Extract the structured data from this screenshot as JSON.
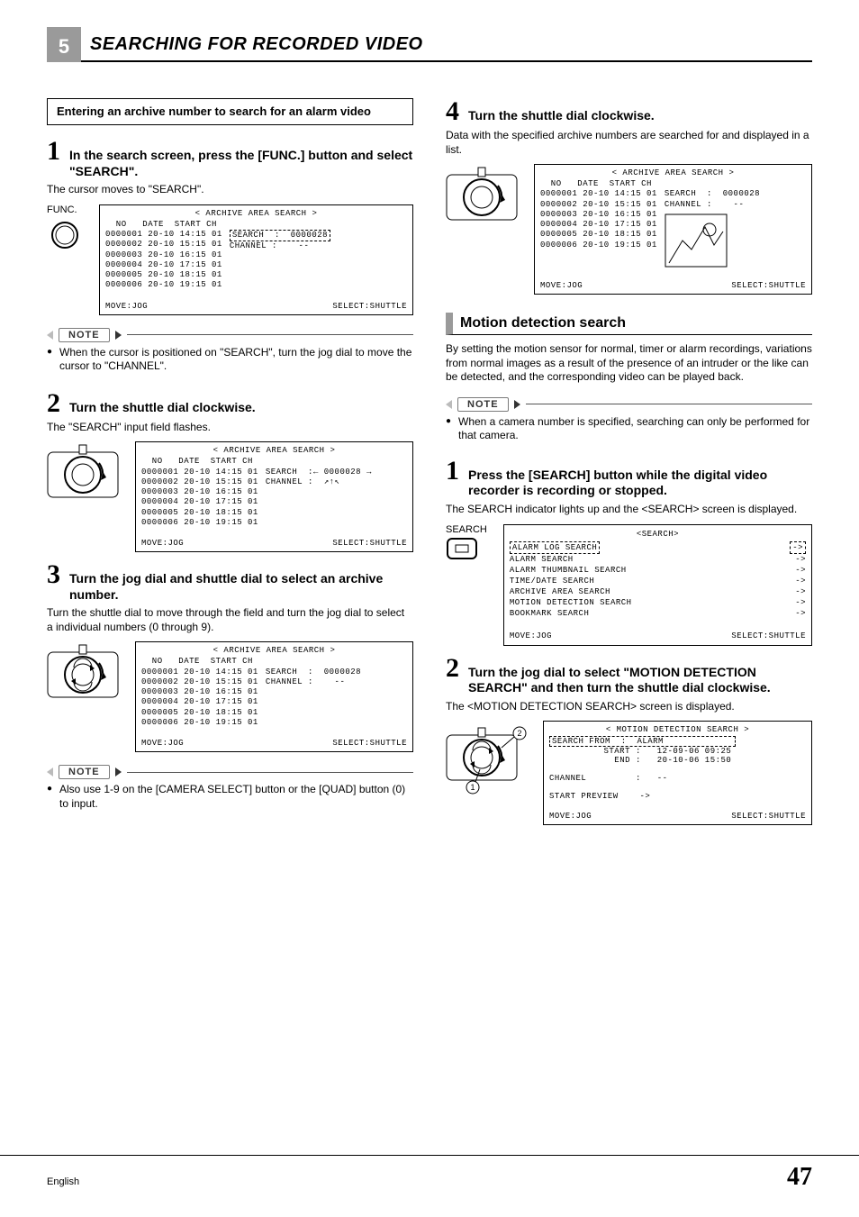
{
  "chapter": {
    "number": "5",
    "title": "SEARCHING FOR RECORDED VIDEO"
  },
  "intro_box": "Entering an archive number to search for an alarm video",
  "steps_left": {
    "s1": {
      "num": "1",
      "title": "In the search screen, press the [FUNC.] button and select \"SEARCH\".",
      "body": "The cursor moves to \"SEARCH\"."
    },
    "s2": {
      "num": "2",
      "title": "Turn the shuttle dial clockwise.",
      "body": "The \"SEARCH\" input field flashes."
    },
    "s3": {
      "num": "3",
      "title": "Turn the jog dial and shuttle dial to select an archive number.",
      "body": "Turn the shuttle dial to move through the field and turn the jog dial to select a individual numbers (0 through 9)."
    }
  },
  "notes": {
    "n1": "When the cursor is positioned on \"SEARCH\", turn the jog dial to move the cursor to \"CHANNEL\".",
    "n2": "Also use 1-9 on the [CAMERA SELECT] button or the [QUAD] button (0) to input.",
    "n3": "When a camera number is specified, searching can only be performed for that camera."
  },
  "label_func": "FUNC.",
  "label_search": "SEARCH",
  "label_note": "NOTE",
  "archive_screen": {
    "title": "< ARCHIVE AREA SEARCH >",
    "header": "  NO   DATE  START CH",
    "rows": [
      "0000001 20-10 14:15 01",
      "0000002 20-10 15:15 01",
      "0000003 20-10 16:15 01",
      "0000004 20-10 17:15 01",
      "0000005 20-10 18:15 01",
      "0000006 20-10 19:15 01"
    ],
    "search_label": "SEARCH  :",
    "search_val_boxed": "0000028",
    "search_val": "0000028",
    "channel_label": "CHANNEL :",
    "channel_val": "--",
    "footer_left": "MOVE:JOG",
    "footer_right": "SELECT:SHUTTLE"
  },
  "steps_right": {
    "s4": {
      "num": "4",
      "title": "Turn the shuttle dial clockwise.",
      "body": "Data with the specified archive numbers are searched for and displayed in a list."
    }
  },
  "section_motion": {
    "title": "Motion detection search",
    "intro": "By setting the motion sensor for normal, timer or alarm recordings, variations from normal images as a result of the presence of an intruder or the like can be detected, and the corresponding video can be played back."
  },
  "steps_motion": {
    "s1": {
      "num": "1",
      "title": "Press the [SEARCH] button while the digital video recorder is recording or stopped.",
      "body": "The SEARCH indicator lights up and the <SEARCH> screen is displayed."
    },
    "s2": {
      "num": "2",
      "title": "Turn the jog dial to select \"MOTION DETECTION SEARCH\" and then turn the shuttle dial clockwise.",
      "body": "The <MOTION DETECTION SEARCH> screen is displayed."
    }
  },
  "search_menu": {
    "title": "<SEARCH>",
    "items": [
      "ALARM LOG SEARCH",
      "ALARM SEARCH",
      "ALARM THUMBNAIL SEARCH",
      "TIME/DATE SEARCH",
      "ARCHIVE AREA SEARCH",
      "MOTION DETECTION SEARCH",
      "BOOKMARK SEARCH"
    ],
    "arrow": "->"
  },
  "md_screen": {
    "title": "< MOTION DETECTION SEARCH >",
    "search_from_label": "SEARCH FROM",
    "search_from_val": "ALARM",
    "start_label": "START",
    "start_val": "12-09-06  09:25",
    "end_label": "END",
    "end_val": "20-10-06  15:50",
    "channel_label": "CHANNEL",
    "channel_val": "--",
    "preview_label": "START PREVIEW",
    "preview_arrow": "->"
  },
  "footer": {
    "lang": "English",
    "page": "47"
  }
}
